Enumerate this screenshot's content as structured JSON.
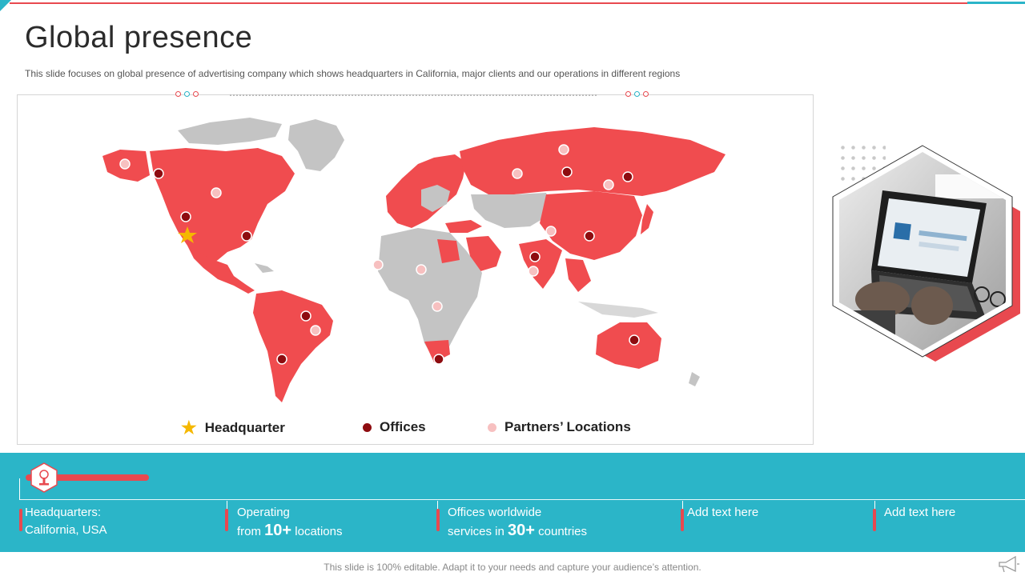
{
  "title": "Global presence",
  "subtitle": "This slide focuses on global presence of advertising company which shows headquarters in California, major clients and our operations in different regions",
  "legend": {
    "headquarter": "Headquarter",
    "offices": "Offices",
    "partners": "Partners’ Locations"
  },
  "colors": {
    "accent_red": "#e8494f",
    "accent_teal": "#2bb5c8",
    "map_active": "#f04c4f",
    "map_inactive": "#c4c4c4",
    "office_dot": "#8e0c10",
    "partner_dot": "#f7c0c0",
    "hq_star": "#f5b800"
  },
  "highlights": [
    {
      "lines": [
        "Headquarters:",
        "California, USA"
      ]
    },
    {
      "lines": [
        "Operating"
      ],
      "prefix": "from ",
      "number": "10+",
      "suffix": " locations"
    },
    {
      "lines": [
        "Offices worldwide"
      ],
      "prefix": "services in ",
      "number": "30+",
      "suffix": " countries"
    },
    {
      "lines": [
        "Add text here"
      ]
    },
    {
      "lines": [
        "Add text here"
      ]
    }
  ],
  "footer": "This slide is 100% editable. Adapt it to your needs and capture your audience’s attention.",
  "icons": {
    "hq": "star-icon",
    "office": "dot-icon",
    "partner": "dot-icon",
    "band_badge": "award-icon",
    "footer_icon": "megaphone-icon"
  }
}
